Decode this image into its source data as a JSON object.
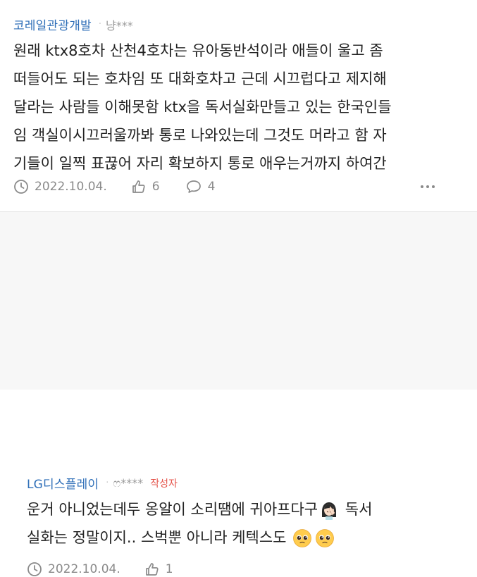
{
  "comment": {
    "company": "코레일관광개발",
    "nickname": "냥***",
    "lines": [
      "원래 ktx8호차 산천4호차는 유아동반석이라 애들이 울고 좀",
      "떠들어도 되는 호차임 또 대화호차고 근데 시끄럽다고 제지해",
      "달라는 사람들 이해못함 ktx을 독서실화만들고 있는 한국인들",
      "임 객실이시끄러울까봐 통로 나와있는데 그것도 머라고 함 자",
      "기들이 일찍 표끊어 자리 확보하지 통로 애우는거까지 하여간"
    ],
    "date": "2022.10.04.",
    "likes": "6",
    "replies": "4"
  },
  "reply": {
    "company": "LG디스플레이",
    "nickname": "ෆ****",
    "writer_badge": "작성자",
    "line1_before": "운거 아니었는데두 옹알이 소리땜에 귀아프다구",
    "line1_after": " 독서",
    "line2": "실화는 정말이지.. 스벅뿐 아니라 케텍스도",
    "date": "2022.10.04.",
    "likes": "1"
  },
  "colors": {
    "company": "#2f6fb8",
    "writer_badge": "#e5544b",
    "meta": "#8a8a8a",
    "reply_bg": "#f7f7f7"
  },
  "icons": [
    "clock-icon",
    "thumbs-up-icon",
    "speech-bubble-icon",
    "more-dots-icon",
    "woman-facepalm-emoji",
    "pleading-face-emoji"
  ]
}
